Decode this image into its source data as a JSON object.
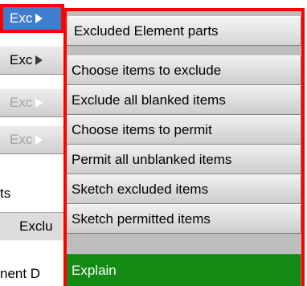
{
  "left_panel": {
    "buttons": [
      {
        "label": "Exc",
        "state": "selected"
      },
      {
        "label": "Exc",
        "state": "normal"
      },
      {
        "label": "Exc",
        "state": "disabled"
      },
      {
        "label": "Exc",
        "state": "disabled"
      }
    ],
    "section_label": "ts",
    "sunken_label": "Exclu",
    "bottom_label": "nent D"
  },
  "popup_menu": {
    "title": "Excluded Element parts",
    "items": [
      "Choose items to exclude",
      "Exclude all blanked items",
      "Choose items to permit",
      "Permit all unblanked items",
      "Sketch excluded items",
      "Sketch permitted items"
    ],
    "explain_label": "Explain"
  },
  "colors": {
    "highlight_border": "#ff0000",
    "selected_button": "#3f7ecf",
    "explain_button": "#138a13"
  }
}
